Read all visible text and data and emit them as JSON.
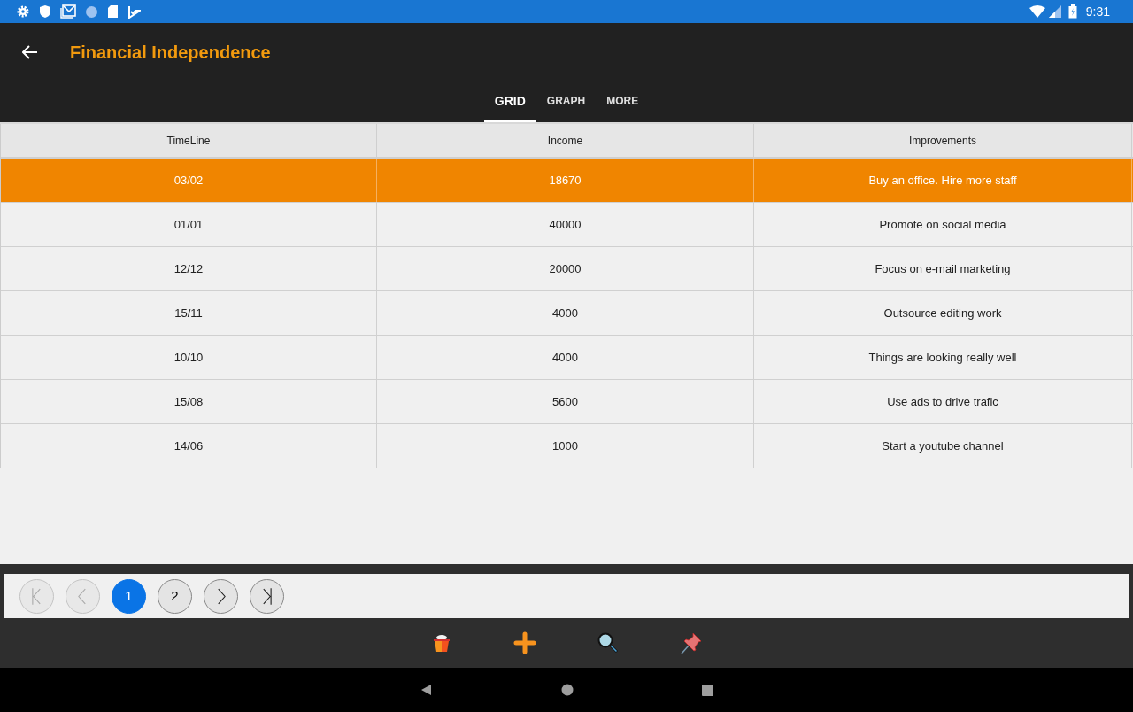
{
  "status_bar": {
    "time": "9:31"
  },
  "app_bar": {
    "title": "Financial Independence"
  },
  "tabs": [
    {
      "label": "GRID",
      "selected": true
    },
    {
      "label": "GRAPH",
      "selected": false
    },
    {
      "label": "MORE",
      "selected": false
    }
  ],
  "table": {
    "columns": [
      "TimeLine",
      "Income",
      "Improvements"
    ],
    "rows": [
      {
        "cells": [
          "03/02",
          "18670",
          "Buy an office. Hire more staff"
        ],
        "selected": true
      },
      {
        "cells": [
          "01/01",
          "40000",
          "Promote on social media"
        ],
        "selected": false
      },
      {
        "cells": [
          "12/12",
          "20000",
          "Focus on e-mail marketing"
        ],
        "selected": false
      },
      {
        "cells": [
          "15/11",
          "4000",
          "Outsource editing work"
        ],
        "selected": false
      },
      {
        "cells": [
          "10/10",
          "4000",
          "Things are looking really well"
        ],
        "selected": false
      },
      {
        "cells": [
          "15/08",
          "5600",
          "Use ads to drive trafic"
        ],
        "selected": false
      },
      {
        "cells": [
          "14/06",
          "1000",
          "Start a youtube channel"
        ],
        "selected": false
      }
    ]
  },
  "pager": [
    {
      "kind": "first",
      "disabled": true
    },
    {
      "kind": "prev",
      "disabled": true
    },
    {
      "kind": "page",
      "label": "1",
      "selected": true
    },
    {
      "kind": "page",
      "label": "2",
      "selected": false
    },
    {
      "kind": "next",
      "disabled": false
    },
    {
      "kind": "last",
      "disabled": false
    }
  ]
}
